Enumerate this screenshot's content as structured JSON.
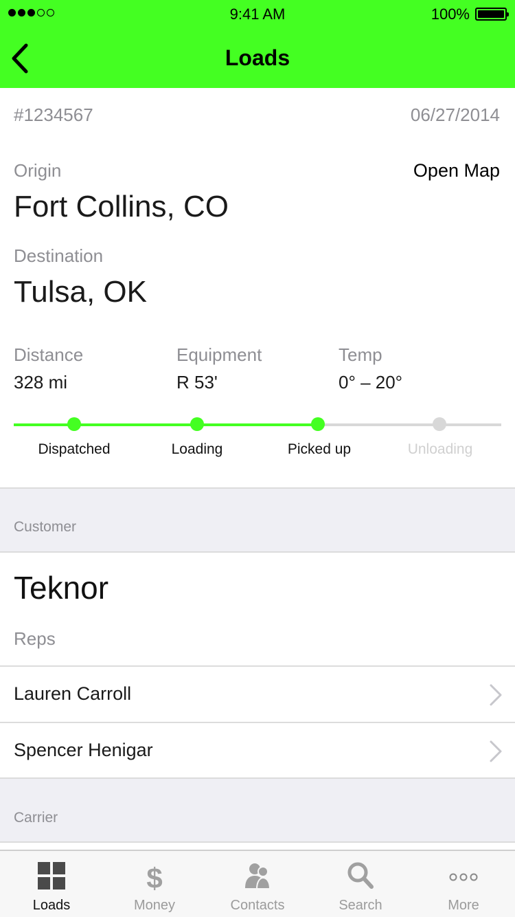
{
  "status_bar": {
    "time": "9:41 AM",
    "battery": "100%"
  },
  "nav": {
    "title": "Loads"
  },
  "load": {
    "id": "#1234567",
    "date": "06/27/2014",
    "origin_label": "Origin",
    "origin": "Fort Collins, CO",
    "open_map": "Open Map",
    "destination_label": "Destination",
    "destination": "Tulsa, OK",
    "stats": [
      {
        "label": "Distance",
        "value": "328 mi"
      },
      {
        "label": "Equipment",
        "value": "R 53'"
      },
      {
        "label": "Temp",
        "value": "0° – 20°"
      }
    ]
  },
  "progress": {
    "steps": [
      {
        "label": "Dispatched",
        "done": true
      },
      {
        "label": "Loading",
        "done": true
      },
      {
        "label": "Picked up",
        "done": true
      },
      {
        "label": "Unloading",
        "done": false
      }
    ],
    "active_color": "#44ff22",
    "pending_color": "#d8d8d8"
  },
  "customer_section": {
    "header": "Customer",
    "name": "Teknor",
    "reps_label": "Reps",
    "reps": [
      "Lauren Carroll",
      "Spencer Henigar"
    ]
  },
  "carrier_section": {
    "header": "Carrier"
  },
  "tabs": [
    {
      "label": "Loads",
      "icon": "grid-icon",
      "active": true
    },
    {
      "label": "Money",
      "icon": "dollar-icon",
      "active": false
    },
    {
      "label": "Contacts",
      "icon": "contacts-icon",
      "active": false
    },
    {
      "label": "Search",
      "icon": "search-icon",
      "active": false
    },
    {
      "label": "More",
      "icon": "more-icon",
      "active": false
    }
  ]
}
